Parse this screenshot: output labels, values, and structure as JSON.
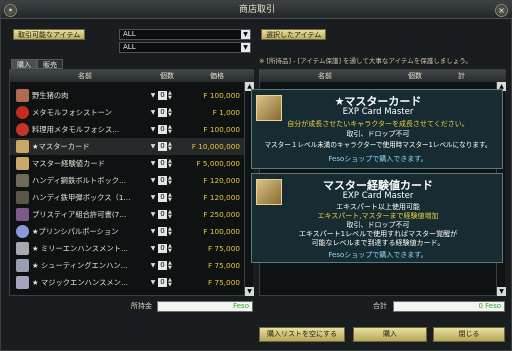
{
  "window": {
    "title": "商店取引"
  },
  "filters": {
    "tradable_label": "取引可能なアイテム",
    "select1": "ALL",
    "select2": "ALL",
    "selected_label": "選択したアイテム"
  },
  "tabs": [
    {
      "label": "購入"
    },
    {
      "label": "販売"
    }
  ],
  "list_header": {
    "name": "名前",
    "qty": "個数",
    "price": "価格"
  },
  "items": [
    {
      "name": "野生猪の肉",
      "qty": "0",
      "price": "F 100,000",
      "icon_color": "#b06a52"
    },
    {
      "name": "メタモルフォシストーン",
      "qty": "0",
      "price": "F 1,000",
      "icon_color": "#c42a1e"
    },
    {
      "name": "料理用メタモルフォシス...",
      "qty": "0",
      "price": "F 100,000",
      "icon_color": "#c4342a"
    },
    {
      "name": "★マスターカード",
      "qty": "0",
      "price": "F 10,000,000",
      "icon_color": "#c8a866"
    },
    {
      "name": "マスター経験値カード",
      "qty": "0",
      "price": "F 5,000,000",
      "icon_color": "#c8a866"
    },
    {
      "name": "ハンディ鋼鉄ボルトボック...",
      "qty": "0",
      "price": "F 120,000",
      "icon_color": "#6e6a5a"
    },
    {
      "name": "ハンディ鉄甲弾ボックス（1...",
      "qty": "0",
      "price": "F 120,000",
      "icon_color": "#5c5648"
    },
    {
      "name": "プリスティア組合許可書(7...",
      "qty": "0",
      "price": "F 250,000",
      "icon_color": "#7e5a8a"
    },
    {
      "name": "★プリンシパルポーション",
      "qty": "0",
      "price": "F 100,000",
      "icon_color": "#8a9ad8"
    },
    {
      "name": "★ ミリーエンハンスメント...",
      "qty": "0",
      "price": "F 75,000",
      "icon_color": "#a8a8b4"
    },
    {
      "name": "★ シューティングエンハン...",
      "qty": "0",
      "price": "F 75,000",
      "icon_color": "#9a9eae"
    },
    {
      "name": "★ マジックエンハンスメン...",
      "qty": "0",
      "price": "F 75,000",
      "icon_color": "#a6a2c2"
    }
  ],
  "notice": "※ [所持品] - [アイテム保護] を通して大事なアイテムを保護しましょう。",
  "cart_header": {
    "name": "名前",
    "qty": "個数",
    "total": "計"
  },
  "tooltip1": {
    "title": "★マスターカード",
    "subtitle": "EXP Card Master",
    "desc1": "自分が成長させたいキャラクターを成長させてください。",
    "desc2": "取引、ドロップ不可",
    "desc3": "マスター１レベル未満のキャラクターで使用時マスター1レベルになります。",
    "shop": "Fesoショップで購入できます。"
  },
  "tooltip2": {
    "title": "マスター経験値カード",
    "subtitle": "EXP Card Master",
    "line1": "エキスパート以上使用可能",
    "line2": "エキスパート,マスターまで経験値増加",
    "line3": "取引、ドロップ不可",
    "desc1": "エキスパート1レベルで使用すればマスター覚醒が",
    "desc2": "可能なレベルまで到達する経験値カード。",
    "shop": "Fesoショップで購入できます。"
  },
  "footer": {
    "owned_label": "所持金",
    "owned_value": "Feso",
    "total_label": "合計",
    "total_value": "0 Feso",
    "clear_button": "購入リストを空にする",
    "buy_button": "購入",
    "close_button": "閉じる"
  },
  "colors": {
    "price": "#e8c63f",
    "feso": "#2aaa2a",
    "button": "#d6cd84"
  }
}
